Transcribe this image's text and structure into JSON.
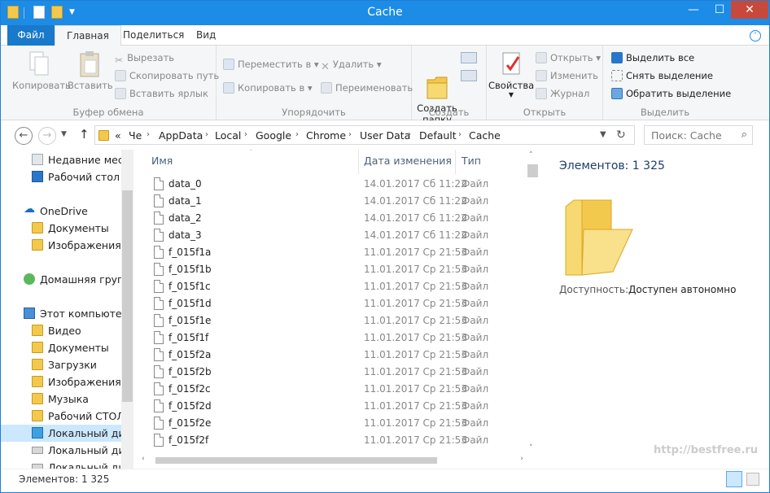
{
  "window": {
    "title": "Cache",
    "minimize": "—",
    "maximize": "☐",
    "close": "✕"
  },
  "tabs": {
    "file": "Файл",
    "home": "Главная",
    "share": "Поделиться",
    "view": "Вид"
  },
  "ribbon": {
    "clipboard": {
      "label": "Буфер обмена",
      "copy": "Копировать",
      "paste": "Вставить",
      "cut": "Вырезать",
      "copy_path": "Скопировать путь",
      "paste_shortcut": "Вставить ярлык"
    },
    "organize": {
      "label": "Упорядочить",
      "move_to": "Переместить в",
      "copy_to": "Копировать в",
      "delete": "Удалить",
      "rename": "Переименовать"
    },
    "create": {
      "label": "Создать",
      "new_folder": "Создать\nпапку"
    },
    "open": {
      "label": "Открыть",
      "properties": "Свойства",
      "open": "Открыть",
      "edit": "Изменить",
      "history": "Журнал"
    },
    "select": {
      "label": "Выделить",
      "select_all": "Выделить все",
      "select_none": "Снять выделение",
      "invert": "Обратить выделение"
    }
  },
  "address": {
    "crumbs": [
      "Че",
      "AppData",
      "Local",
      "Google",
      "Chrome",
      "User Data",
      "Default",
      "Cache"
    ],
    "search_placeholder": "Поиск: Cache"
  },
  "nav": {
    "recent": "Недавние места",
    "desktop": "Рабочий стол",
    "onedrive": "OneDrive",
    "od_docs": "Документы",
    "od_images": "Изображения",
    "homegroup": "Домашняя группа",
    "this_pc": "Этот компьютер",
    "video": "Видео",
    "docs": "Документы",
    "downloads": "Загрузки",
    "images": "Изображения",
    "music": "Музыка",
    "desktop2": "Рабочий СТОЛ",
    "disk1": "Локальный диск",
    "disk2": "Локальный диск",
    "disk3": "Локальный диск"
  },
  "list": {
    "columns": {
      "name": "Имя",
      "date": "Дата изменения",
      "type": "Тип"
    },
    "files": [
      {
        "name": "data_0",
        "date": "14.01.2017 Сб 11:22",
        "type": "Файл"
      },
      {
        "name": "data_1",
        "date": "14.01.2017 Сб 11:22",
        "type": "Файл"
      },
      {
        "name": "data_2",
        "date": "14.01.2017 Сб 11:22",
        "type": "Файл"
      },
      {
        "name": "data_3",
        "date": "14.01.2017 Сб 11:22",
        "type": "Файл"
      },
      {
        "name": "f_015f1a",
        "date": "11.01.2017 Ср 21:53",
        "type": "Файл"
      },
      {
        "name": "f_015f1b",
        "date": "11.01.2017 Ср 21:53",
        "type": "Файл"
      },
      {
        "name": "f_015f1c",
        "date": "11.01.2017 Ср 21:53",
        "type": "Файл"
      },
      {
        "name": "f_015f1d",
        "date": "11.01.2017 Ср 21:53",
        "type": "Файл"
      },
      {
        "name": "f_015f1e",
        "date": "11.01.2017 Ср 21:53",
        "type": "Файл"
      },
      {
        "name": "f_015f1f",
        "date": "11.01.2017 Ср 21:53",
        "type": "Файл"
      },
      {
        "name": "f_015f2a",
        "date": "11.01.2017 Ср 21:53",
        "type": "Файл"
      },
      {
        "name": "f_015f2b",
        "date": "11.01.2017 Ср 21:53",
        "type": "Файл"
      },
      {
        "name": "f_015f2c",
        "date": "11.01.2017 Ср 21:53",
        "type": "Файл"
      },
      {
        "name": "f_015f2d",
        "date": "11.01.2017 Ср 21:53",
        "type": "Файл"
      },
      {
        "name": "f_015f2e",
        "date": "11.01.2017 Ср 21:53",
        "type": "Файл"
      },
      {
        "name": "f_015f2f",
        "date": "11.01.2017 Ср 21:53",
        "type": "Файл"
      }
    ]
  },
  "details": {
    "count": "Элементов: 1 325",
    "availability_label": "Доступность:",
    "availability_value": "Доступен автономно"
  },
  "status": {
    "count": "Элементов: 1 325"
  },
  "watermark": "http://bestfree.ru"
}
